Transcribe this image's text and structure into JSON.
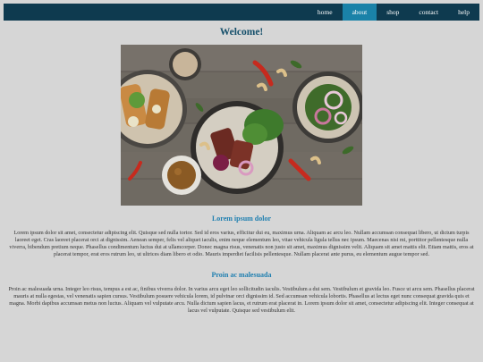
{
  "nav": {
    "items": [
      {
        "label": "home"
      },
      {
        "label": "about"
      },
      {
        "label": "shop"
      },
      {
        "label": "contact"
      },
      {
        "label": "help"
      }
    ],
    "active": "about"
  },
  "page": {
    "title": "Welcome!"
  },
  "sections": [
    {
      "heading": "Lorem ipsum dolor",
      "body": "Lorem ipsum dolor sit amet, consectetur adipiscing elit. Quisque sed nulla tortor. Sed id eros varius, efficitur dui eu, maximus urna. Aliquam ac arcu leo. Nullam accumsan consequat libero, ut dictum turpis laoreet eget. Cras laoreet placerat orci at dignissim. Aenean semper, felis vel aliquet iaculis, enim neque elementum leo, vitae vehicula ligula tellus nec ipsum. Maecenas nisi mi, porttitor pellentesque nulla viverra, bibendum pretium neque. Phasellus condimentum luctus dui at ullamcorper. Donec magna risus, venenatis non justo sit amet, maximus dignissim velit. Aliquam sit amet mattis elit. Etiam mattis, eros at placerat tempor, erat eros rutrum leo, ut ultrices diam libero et odio. Mauris imperdiet facilisis pellentesque. Nullam placerat ante purus, eu elementum augue tempor sed."
    },
    {
      "heading": "Proin ac malesuada",
      "body": "Proin ac malesuada urna. Integer leo risus, tempus a est ac, finibus viverra dolor. In varius arcu eget leo sollicitudin iaculis. Vestibulum a dui sem. Vestibulum et gravida leo. Fusce ut arcu sem. Phasellus placerat mauris at nulla egestas, vel venenatis sapien cursus. Vestibulum posuere vehicula lorem, id pulvinar orci dignissim id. Sed accumsan vehicula lobortis. Phasellus at lectus eget nunc consequat gravida quis et magna. Morbi dapibus accumsan metus non luctus. Aliquam vel vulputate arcu. Nulla dictum sapien lacus, et rutrum erat placerat in. Lorem ipsum dolor sit amet, consectetur adipiscing elit. Integer consequat at lacus vel vulputate. Quisque sed vestibulum elit."
    }
  ],
  "colors": {
    "navbar": "#0e3a4f",
    "nav_active": "#1a82a8",
    "title": "#16506b",
    "heading": "#1f7fb0",
    "background": "#d6d6d6"
  }
}
